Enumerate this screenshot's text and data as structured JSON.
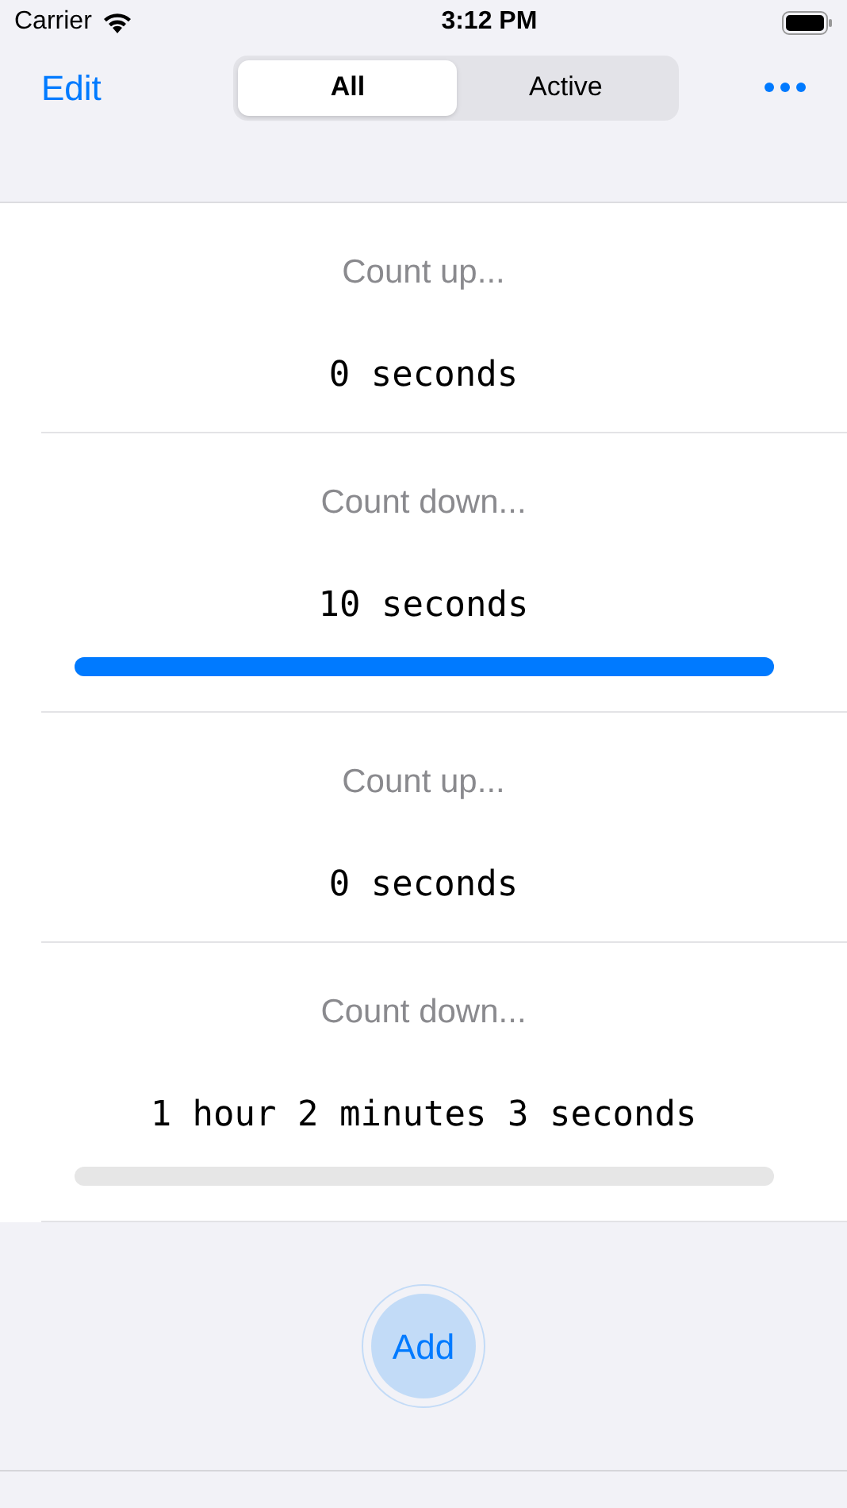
{
  "status_bar": {
    "carrier": "Carrier",
    "time": "3:12 PM"
  },
  "nav": {
    "edit": "Edit",
    "segments": [
      {
        "label": "All",
        "selected": true
      },
      {
        "label": "Active",
        "selected": false
      }
    ]
  },
  "timers": [
    {
      "kind": "countup",
      "label": "Count up...",
      "value": "0 seconds"
    },
    {
      "kind": "countdown",
      "label": "Count down...",
      "value": "10 seconds",
      "level": 1
    },
    {
      "kind": "countup",
      "label": "Count up...",
      "value": "0 seconds"
    },
    {
      "kind": "countdown",
      "label": "Count down...",
      "value": "1 hour 2 minutes 3 seconds",
      "level": 0
    }
  ],
  "add_button": "Add"
}
